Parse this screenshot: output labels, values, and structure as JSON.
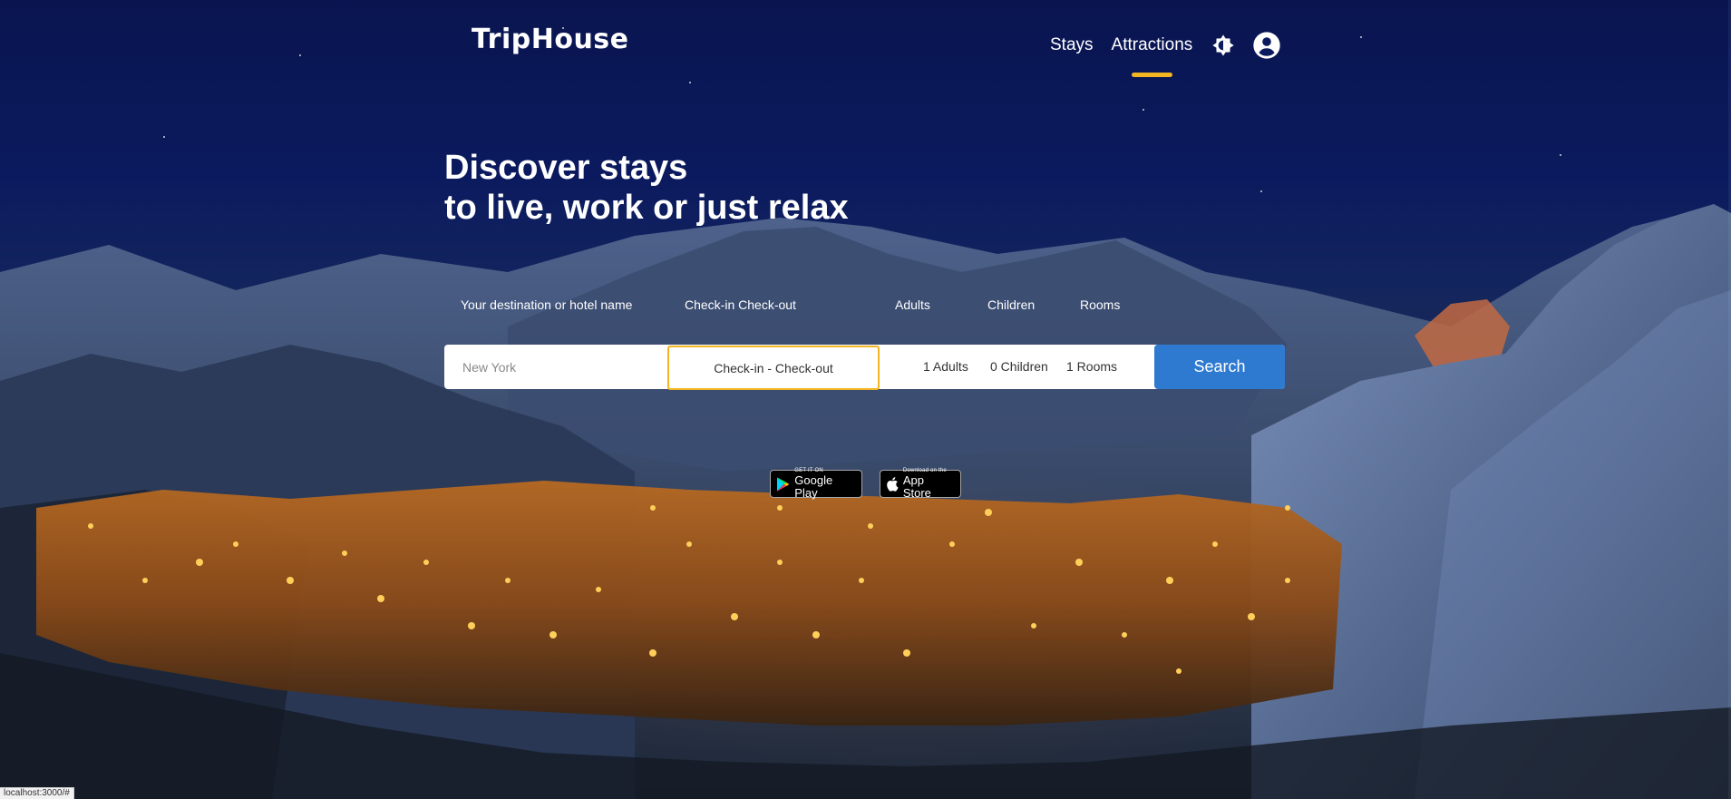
{
  "brand": {
    "logo": "TripHouse"
  },
  "nav": {
    "items": [
      {
        "label": "Stays",
        "active": false
      },
      {
        "label": "Attractions",
        "active": true
      }
    ],
    "theme_icon": "brightness-icon",
    "account_icon": "account-circle-icon",
    "active_underline_color": "#f3b521"
  },
  "hero": {
    "line1": "Discover stays",
    "line2": "to live, work or just relax"
  },
  "search": {
    "labels": {
      "destination": "Your destination or hotel name",
      "dates": "Check-in Check-out",
      "adults": "Adults",
      "children": "Children",
      "rooms": "Rooms"
    },
    "destination_placeholder": "New York",
    "dates_value": "Check-in - Check-out",
    "adults_value": "1 Adults",
    "children_value": "0 Children",
    "rooms_value": "1 Rooms",
    "button_label": "Search",
    "button_color": "#2f7ad1",
    "focus_color": "#f3b521"
  },
  "apps": {
    "google_small": "GET IT ON",
    "google_large": "Google Play",
    "apple_small": "Download on the",
    "apple_large": "App Store"
  },
  "status_bar": {
    "url": "localhost:3000/#"
  }
}
